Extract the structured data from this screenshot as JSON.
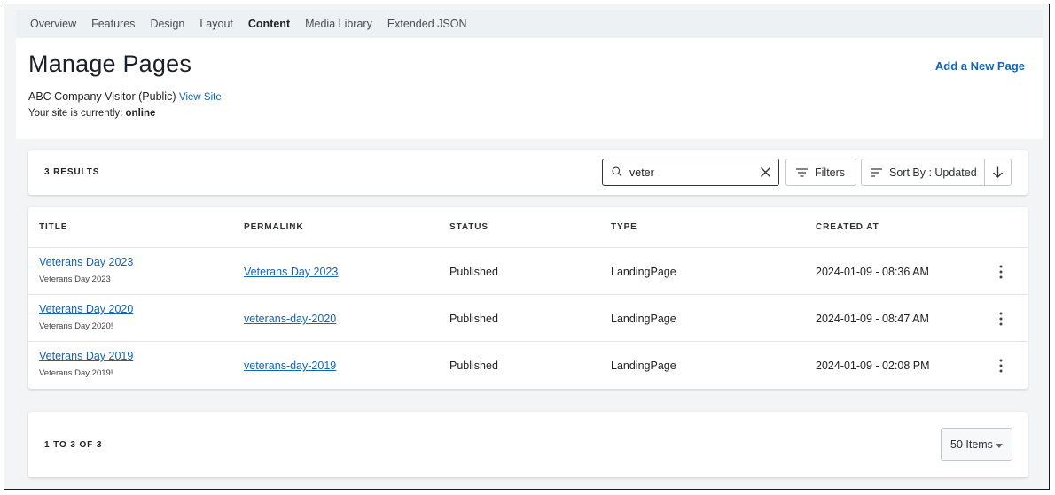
{
  "nav": {
    "tabs": [
      {
        "label": "Overview"
      },
      {
        "label": "Features"
      },
      {
        "label": "Design"
      },
      {
        "label": "Layout"
      },
      {
        "label": "Content"
      },
      {
        "label": "Media Library"
      },
      {
        "label": "Extended JSON"
      }
    ],
    "active_tab": "Content"
  },
  "header": {
    "title": "Manage Pages",
    "add_link": "Add a New Page",
    "site_name": "ABC Company Visitor (Public)",
    "view_site": "View Site",
    "status_prefix": "Your site is currently:",
    "status_value": "online"
  },
  "toolbar": {
    "results": "3 RESULTS",
    "search_value": "veter",
    "filters_label": "Filters",
    "sort_label": "Sort By : Updated"
  },
  "table": {
    "columns": [
      "TITLE",
      "PERMALINK",
      "STATUS",
      "TYPE",
      "CREATED AT"
    ],
    "rows": [
      {
        "title": "Veterans Day 2023",
        "subtitle": "Veterans Day 2023",
        "permalink": "Veterans Day 2023",
        "status": "Published",
        "type": "LandingPage",
        "created": "2024-01-09 - 08:36 AM"
      },
      {
        "title": "Veterans Day 2020",
        "subtitle": "Veterans Day 2020!",
        "permalink": "veterans-day-2020",
        "status": "Published",
        "type": "LandingPage",
        "created": "2024-01-09 - 08:47 AM"
      },
      {
        "title": "Veterans Day 2019",
        "subtitle": "Veterans Day 2019!",
        "permalink": "veterans-day-2019",
        "status": "Published",
        "type": "LandingPage",
        "created": "2024-01-09 - 02:08 PM"
      }
    ]
  },
  "pager": {
    "range": "1 TO 3 OF 3",
    "items_per_page": "50 Items"
  },
  "colors": {
    "link": "#1264b8",
    "page_bg": "#f3f4f5",
    "nav_bg": "#edf1f4"
  }
}
